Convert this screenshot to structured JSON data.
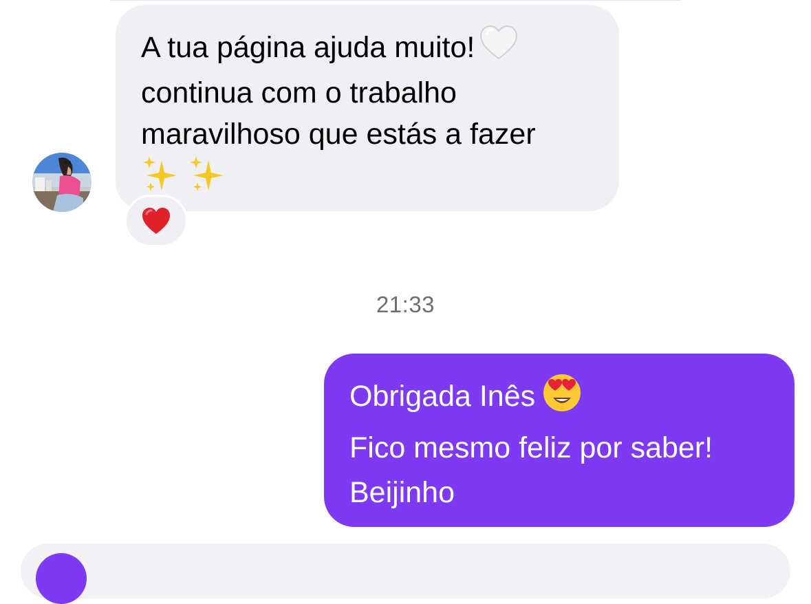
{
  "conversation": {
    "incoming_message": {
      "lines": [
        "A tua página ajuda muito!",
        "continua com o trabalho",
        "maravilhoso que estás a fazer"
      ],
      "trailing_emoji": "white-heart",
      "sparkles_emoji": "sparkles",
      "reaction": "red-heart"
    },
    "timestamp": "21:33",
    "outgoing_message": {
      "lines": [
        "Obrigada Inês",
        "Fico mesmo feliz por saber!",
        "Beijinho"
      ],
      "trailing_emoji": "heart-eyes"
    }
  },
  "colors": {
    "incoming_bubble": "#efeff4",
    "outgoing_bubble": "#7d3af2",
    "timestamp_text": "#6d6d72"
  }
}
